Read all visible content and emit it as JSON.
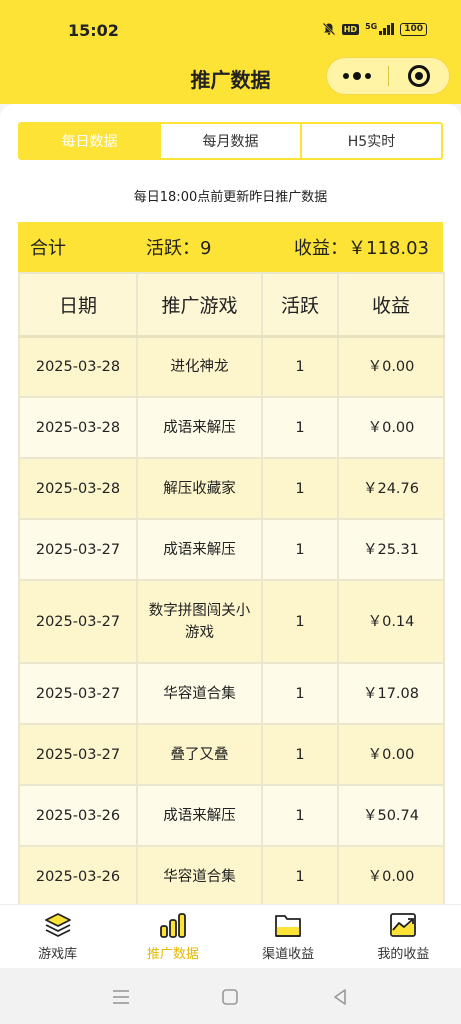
{
  "status": {
    "time": "15:02",
    "hd": "HD",
    "network": "5G",
    "battery": "100"
  },
  "nav": {
    "title": "推广数据",
    "more_icon": "more-dots-icon",
    "close_icon": "target-ring-icon"
  },
  "tabs": [
    {
      "label": "每日数据",
      "active": true
    },
    {
      "label": "每月数据",
      "active": false
    },
    {
      "label": "H5实时",
      "active": false
    }
  ],
  "notice": "每日18:00点前更新昨日推广数据",
  "summary": {
    "total_label": "合计",
    "active_label": "活跃：",
    "active_value": "9",
    "income_label": "收益：",
    "income_value": "￥118.03"
  },
  "table": {
    "headers": [
      "日期",
      "推广游戏",
      "活跃",
      "收益"
    ],
    "rows": [
      {
        "date": "2025-03-28",
        "game": "进化神龙",
        "active": "1",
        "income": "￥0.00"
      },
      {
        "date": "2025-03-28",
        "game": "成语来解压",
        "active": "1",
        "income": "￥0.00"
      },
      {
        "date": "2025-03-28",
        "game": "解压收藏家",
        "active": "1",
        "income": "￥24.76"
      },
      {
        "date": "2025-03-27",
        "game": "成语来解压",
        "active": "1",
        "income": "￥25.31"
      },
      {
        "date": "2025-03-27",
        "game": "数字拼图闯关小游戏",
        "active": "1",
        "income": "￥0.14"
      },
      {
        "date": "2025-03-27",
        "game": "华容道合集",
        "active": "1",
        "income": "￥17.08"
      },
      {
        "date": "2025-03-27",
        "game": "叠了又叠",
        "active": "1",
        "income": "￥0.00"
      },
      {
        "date": "2025-03-26",
        "game": "成语来解压",
        "active": "1",
        "income": "￥50.74"
      },
      {
        "date": "2025-03-26",
        "game": "华容道合集",
        "active": "1",
        "income": "￥0.00"
      }
    ]
  },
  "bottom_nav": [
    {
      "label": "游戏库",
      "icon": "layers-stack-icon",
      "active": false
    },
    {
      "label": "推广数据",
      "icon": "bar-chart-icon",
      "active": true
    },
    {
      "label": "渠道收益",
      "icon": "folder-icon",
      "active": false
    },
    {
      "label": "我的收益",
      "icon": "trend-chart-icon",
      "active": false
    }
  ],
  "system_nav": {
    "menu_icon": "menu-lines-icon",
    "home_icon": "home-square-icon",
    "back_icon": "back-triangle-icon"
  },
  "colors": {
    "accent": "#fde336",
    "active_text": "#e6b800",
    "row_odd": "#fdf6cc",
    "row_even": "#fefbe8"
  }
}
